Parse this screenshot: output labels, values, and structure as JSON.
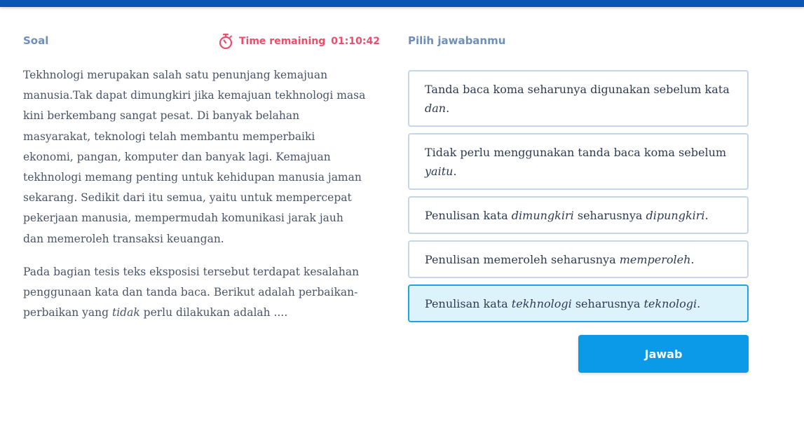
{
  "header": {
    "soal_label": "Soal",
    "timer_label": "Time remaining",
    "timer_value": "01:10:42",
    "timer_color": "#ec4d6c",
    "accent_color": "#0b56b3"
  },
  "question": {
    "paragraph1": "Tekhnologi merupakan salah satu penunjang kemajuan manusia.Tak dapat dimungkiri jika kemajuan tekhnologi masa kini berkembang sangat pesat. Di banyak belahan masyarakat, teknologi telah membantu memperbaiki ekonomi, pangan, komputer dan banyak lagi. Kemajuan tekhnologi memang penting untuk kehidupan manusia jaman sekarang. Sedikit dari itu semua, yaitu untuk mempercepat pekerjaan manusia, mempermudah komunikasi jarak jauh dan memeroleh transaksi keuangan.",
    "paragraph2_before": "Pada bagian tesis teks eksposisi tersebut terdapat kesalahan penggunaan kata dan tanda baca. Berikut adalah perbaikan-perbaikan yang ",
    "paragraph2_em": "tidak",
    "paragraph2_after": " perlu dilakukan adalah ...."
  },
  "answers": {
    "label": "Pilih jawabanmu",
    "options": [
      {
        "t1": "Tanda baca koma seharunya digunakan sebelum kata ",
        "e1": "dan",
        "t2": ".",
        "e2": "",
        "t3": ""
      },
      {
        "t1": "Tidak perlu menggunakan tanda baca koma sebelum ",
        "e1": "yaitu",
        "t2": ".",
        "e2": "",
        "t3": ""
      },
      {
        "t1": "Penulisan kata ",
        "e1": "dimungkiri",
        "t2": " seharusnya ",
        "e2": "dipungkiri",
        "t3": "."
      },
      {
        "t1": "Penulisan memeroleh seharusnya ",
        "e1": "memperoleh",
        "t2": ".",
        "e2": "",
        "t3": ""
      },
      {
        "t1": "Penulisan kata ",
        "e1": "tekhnologi",
        "t2": " seharusnya ",
        "e2": "teknologi",
        "t3": "."
      }
    ],
    "selected_index": 4,
    "submit_label": "Jawab"
  }
}
